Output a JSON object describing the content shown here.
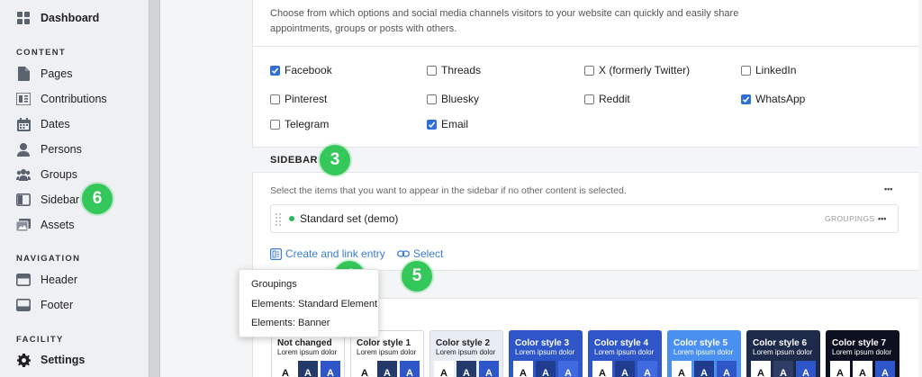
{
  "sidebar": {
    "dashboard": "Dashboard",
    "content_heading": "CONTENT",
    "content_items": [
      "Pages",
      "Contributions",
      "Dates",
      "Persons",
      "Groups",
      "Sidebar",
      "Assets"
    ],
    "navigation_heading": "NAVIGATION",
    "navigation_items": [
      "Header",
      "Footer"
    ],
    "facility_heading": "FACILITY",
    "settings": "Settings"
  },
  "main": {
    "share_description": "Choose from which options and social media channels visitors to your website can quickly and easily share appointments, groups or posts with others.",
    "share_options": [
      {
        "label": "Facebook",
        "checked": true
      },
      {
        "label": "Threads",
        "checked": false
      },
      {
        "label": "X (formerly Twitter)",
        "checked": false
      },
      {
        "label": "LinkedIn",
        "checked": false
      },
      {
        "label": "Pinterest",
        "checked": false
      },
      {
        "label": "Bluesky",
        "checked": false
      },
      {
        "label": "Reddit",
        "checked": false
      },
      {
        "label": "WhatsApp",
        "checked": true
      },
      {
        "label": "Telegram",
        "checked": false
      },
      {
        "label": "Email",
        "checked": true
      }
    ],
    "sidebar_section_title": "SIDEBAR",
    "sidebar_description": "Select the items that you want to appear in the sidebar if no other content is selected.",
    "entry_label": "Standard set (demo)",
    "entry_tag": "GROUPINGS",
    "create_link": "Create and link entry",
    "select_link": "Select",
    "dropdown_items": [
      "Groupings",
      "Elements: Standard Element",
      "Elements: Banner"
    ],
    "more_dots": "•••"
  },
  "color_styles": [
    {
      "title": "Not changed",
      "sub": "Lorem ipsum dolor",
      "bg": "#ffffff",
      "fg": "#222222",
      "swatches": [
        "#ffffff",
        "#243a6b",
        "#2f56c9"
      ]
    },
    {
      "title": "Color style 1",
      "sub": "Lorem ipsum dolor",
      "bg": "#ffffff",
      "fg": "#222222",
      "swatches": [
        "#ffffff",
        "#243a6b",
        "#2f56c9"
      ]
    },
    {
      "title": "Color style 2",
      "sub": "Lorem ipsum dolor",
      "bg": "#e8ecf5",
      "fg": "#222222",
      "swatches": [
        "#ffffff",
        "#243a6b",
        "#2f56c9"
      ]
    },
    {
      "title": "Color style 3",
      "sub": "Lorem ipsum dolor",
      "bg": "#2f56c9",
      "fg": "#ffffff",
      "swatches": [
        "#ffffff",
        "#1f3c8f",
        "#3f6ae0"
      ]
    },
    {
      "title": "Color style 4",
      "sub": "Lorem ipsum dolor",
      "bg": "#2f56c9",
      "fg": "#ffffff",
      "swatches": [
        "#ffffff",
        "#1f3c8f",
        "#3f6ae0"
      ]
    },
    {
      "title": "Color style 5",
      "sub": "Lorem ipsum dolor",
      "bg": "#4a90f0",
      "fg": "#ffffff",
      "swatches": [
        "#ffffff",
        "#1f3c8f",
        "#2f56c9"
      ]
    },
    {
      "title": "Color style 6",
      "sub": "Lorem ipsum dolor",
      "bg": "#1e2a4a",
      "fg": "#ffffff",
      "swatches": [
        "#ffffff",
        "#2f3d66",
        "#2f56c9"
      ]
    },
    {
      "title": "Color style 7",
      "sub": "Lorem ipsum dolor",
      "bg": "#0c1020",
      "fg": "#ffffff",
      "swatches": [
        "#ffffff",
        "#ffffff",
        "#2f56c9"
      ]
    }
  ],
  "markers": [
    "3",
    "4",
    "5",
    "6"
  ],
  "colors": {
    "accent": "#3b7dd8",
    "checkbox": "#2f6fd6",
    "marker_green": "#34c759",
    "status_dot": "#2eb85c"
  }
}
